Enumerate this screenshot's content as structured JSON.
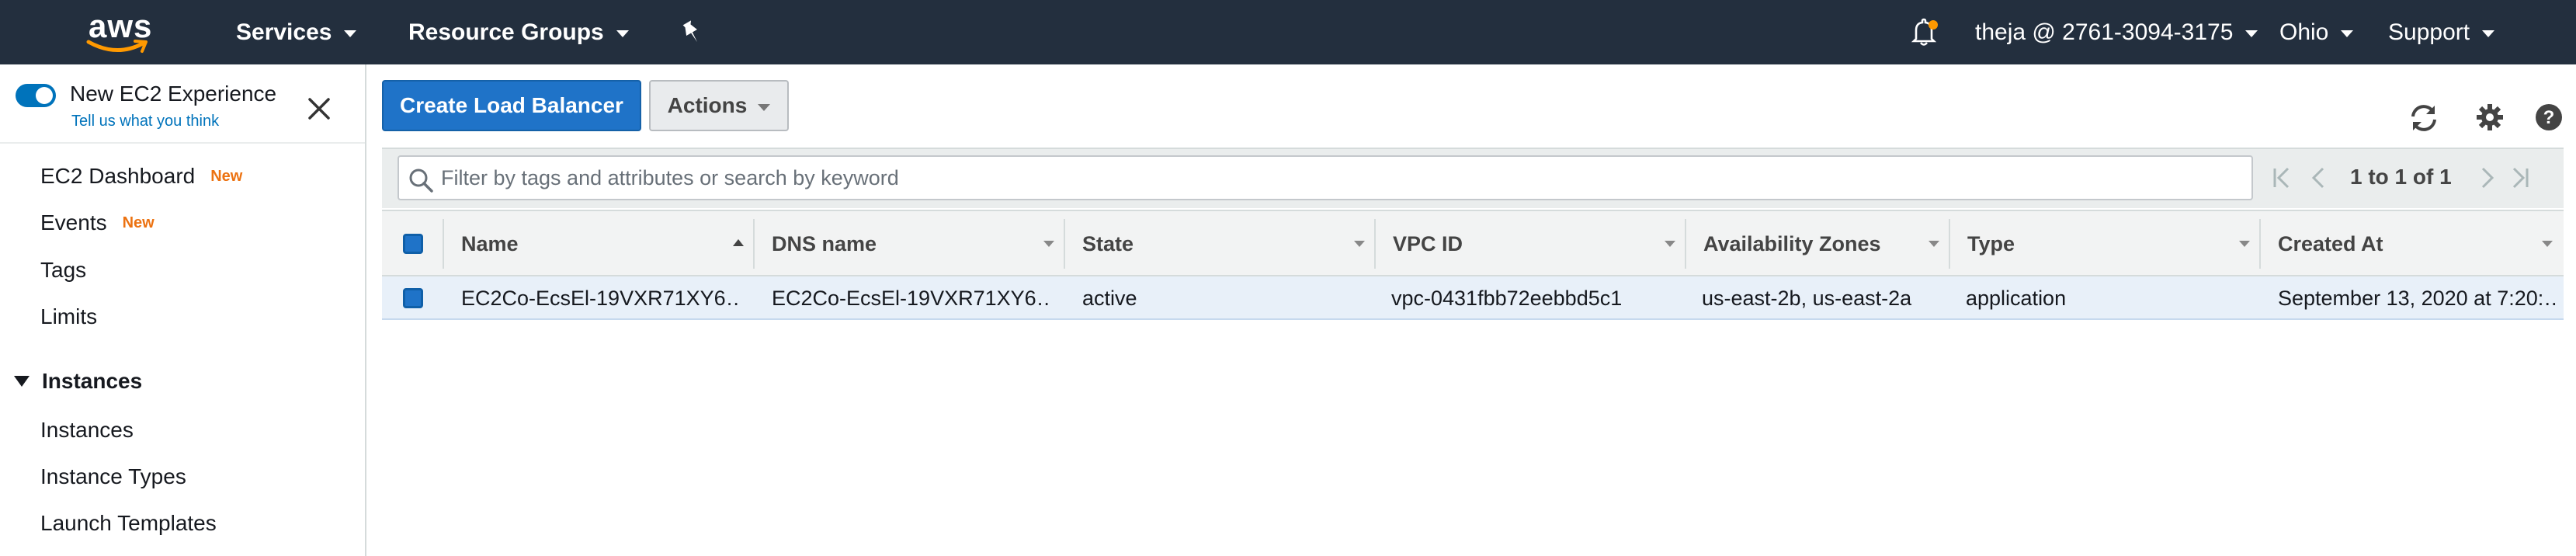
{
  "topnav": {
    "logo": "aws",
    "services": "Services",
    "resource_groups": "Resource Groups",
    "account": "theja @ 2761-3094-3175",
    "region": "Ohio",
    "support": "Support",
    "notification_dot_color": "#ff9900"
  },
  "sidebar": {
    "banner_title": "New EC2 Experience",
    "banner_link": "Tell us what you think",
    "items": [
      {
        "label": "EC2 Dashboard",
        "badge": "New"
      },
      {
        "label": "Events",
        "badge": "New"
      },
      {
        "label": "Tags"
      },
      {
        "label": "Limits"
      }
    ],
    "section": "Instances",
    "section_items": [
      "Instances",
      "Instance Types",
      "Launch Templates"
    ]
  },
  "toolbar": {
    "create_label": "Create Load Balancer",
    "actions_label": "Actions"
  },
  "filter": {
    "placeholder": "Filter by tags and attributes or search by keyword",
    "pagination": "1 to 1 of 1"
  },
  "table": {
    "columns": [
      "Name",
      "DNS name",
      "State",
      "VPC ID",
      "Availability Zones",
      "Type",
      "Created At"
    ],
    "rows": [
      {
        "name": "EC2Co-EcsEl-19VXR71XY6…",
        "dns": "EC2Co-EcsEl-19VXR71XY6…",
        "state": "active",
        "vpc": "vpc-0431fbb72eebbd5c1",
        "az": "us-east-2b, us-east-2a",
        "type": "application",
        "created": "September 13, 2020 at 7:20:…"
      }
    ]
  },
  "colors": {
    "nav_bg": "#232f3e",
    "primary_button": "#1f73c8",
    "link": "#0073bb",
    "new_badge": "#ec7211",
    "selected_row": "#e8f0f9"
  }
}
